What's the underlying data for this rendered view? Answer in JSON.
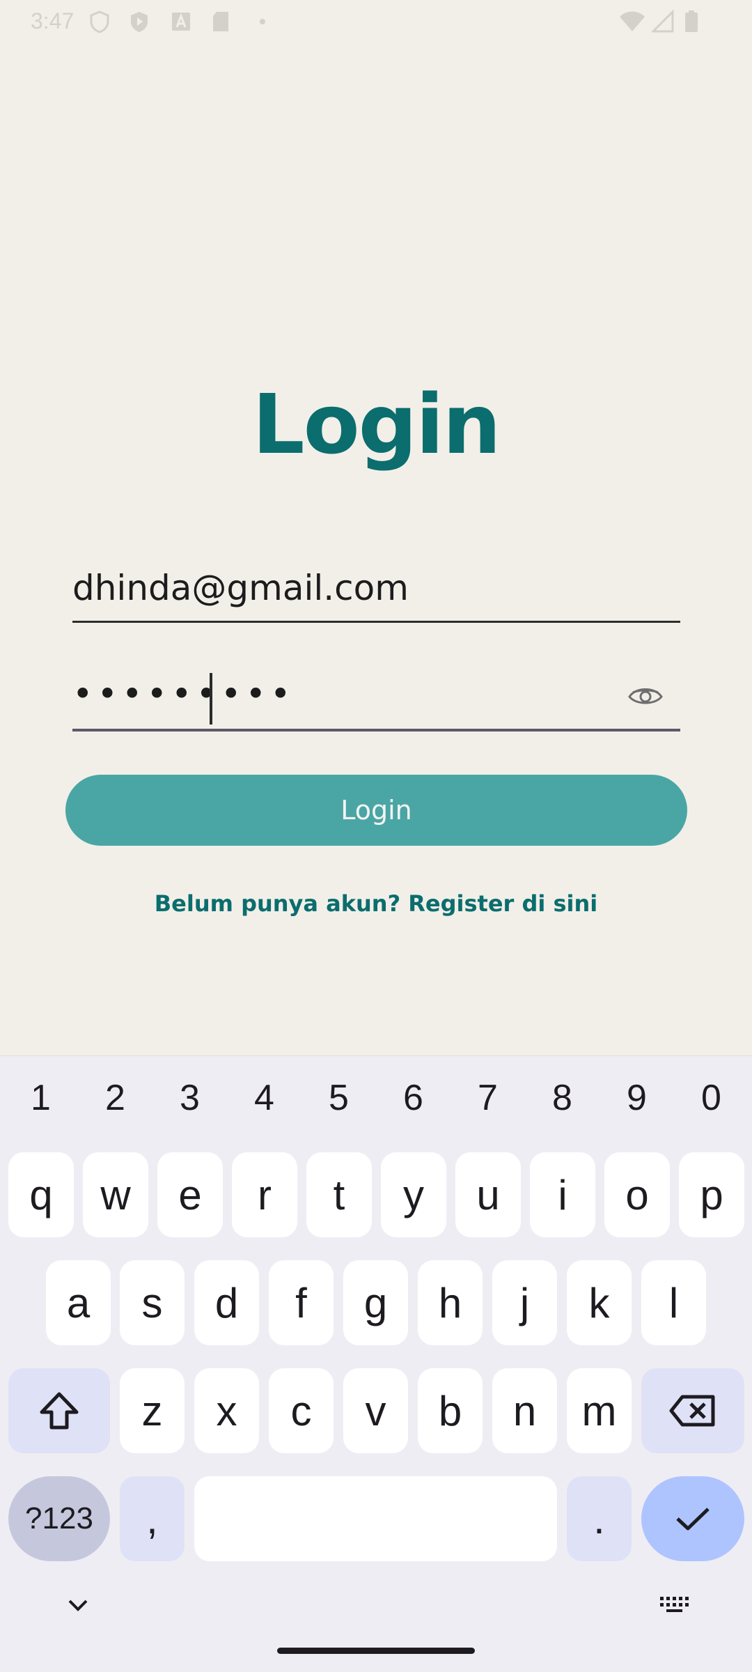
{
  "status": {
    "time": "3:47"
  },
  "title": "Login",
  "email": {
    "value": "dhinda@gmail.com"
  },
  "password": {
    "value": "•••••••••"
  },
  "login_button": "Login",
  "register_link": "Belum punya akun? Register di sini",
  "keyboard": {
    "numbers": [
      "1",
      "2",
      "3",
      "4",
      "5",
      "6",
      "7",
      "8",
      "9",
      "0"
    ],
    "row1": [
      "q",
      "w",
      "e",
      "r",
      "t",
      "y",
      "u",
      "i",
      "o",
      "p"
    ],
    "row2": [
      "a",
      "s",
      "d",
      "f",
      "g",
      "h",
      "j",
      "k",
      "l"
    ],
    "row3": [
      "z",
      "x",
      "c",
      "v",
      "b",
      "n",
      "m"
    ],
    "sym_label": "?123",
    "comma": ",",
    "period": "."
  },
  "colors": {
    "accent": "#0b6d6d",
    "button": "#4aa6a4",
    "background": "#f2efe9"
  }
}
